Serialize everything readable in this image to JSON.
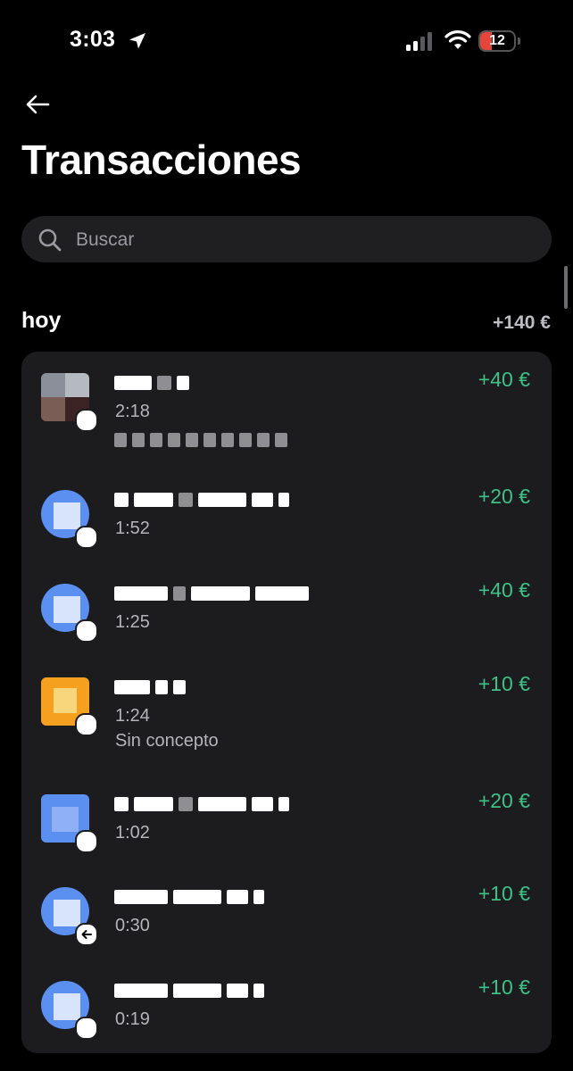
{
  "status_bar": {
    "time": "3:03",
    "battery": "12"
  },
  "header": {
    "title": "Transacciones"
  },
  "search": {
    "placeholder": "Buscar"
  },
  "section": {
    "title": "hoy",
    "total": "+140 €"
  },
  "transactions": [
    {
      "time": "2:18",
      "amount": "+40 €",
      "concept": ""
    },
    {
      "time": "1:52",
      "amount": "+20 €",
      "concept": ""
    },
    {
      "time": "1:25",
      "amount": "+40 €",
      "concept": ""
    },
    {
      "time": "1:24",
      "amount": "+10 €",
      "concept": "Sin concepto"
    },
    {
      "time": "1:02",
      "amount": "+20 €",
      "concept": ""
    },
    {
      "time": "0:30",
      "amount": "+10 €",
      "concept": ""
    },
    {
      "time": "0:19",
      "amount": "+10 €",
      "concept": ""
    }
  ],
  "colors": {
    "positive_amount": "#3ec089",
    "card_bg": "#1c1c1e",
    "search_bg": "#1f1f21"
  }
}
